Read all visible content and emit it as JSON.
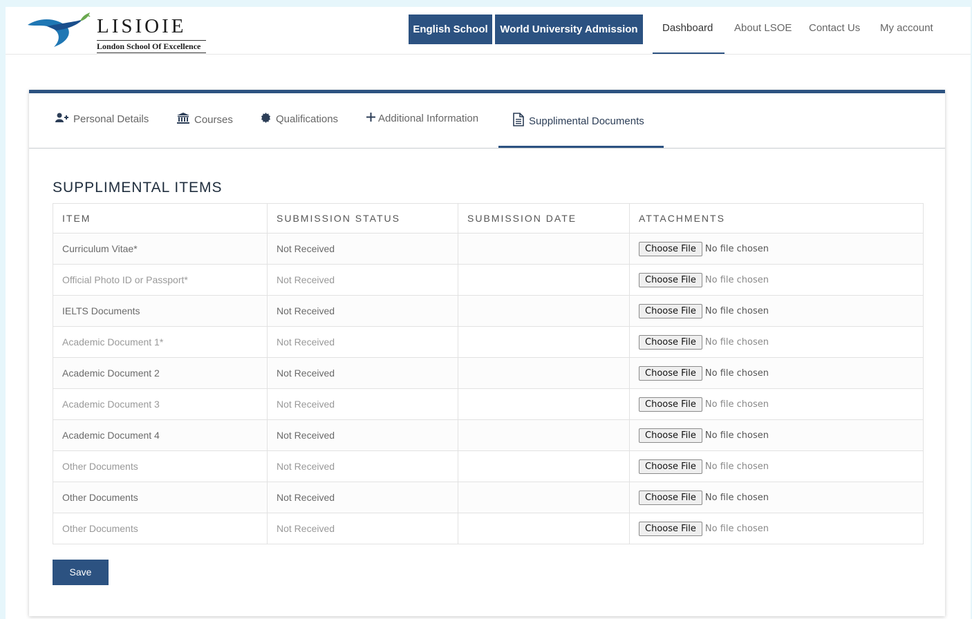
{
  "brand": {
    "name": "LISIOIE",
    "subtitle": "London School Of Excellence"
  },
  "header": {
    "buttons": [
      "English School",
      "World University Admission"
    ],
    "nav": [
      "Dashboard",
      "About LSOE",
      "Contact Us",
      "My account"
    ],
    "active_nav": "Dashboard"
  },
  "tabs": [
    {
      "label": "Personal Details",
      "icon": "user-plus-icon"
    },
    {
      "label": "Courses",
      "icon": "institution-icon"
    },
    {
      "label": "Qualifications",
      "icon": "certificate-icon"
    },
    {
      "label": "Additional Information",
      "icon": "plus-icon"
    },
    {
      "label": "Supplimental Documents",
      "icon": "document-icon"
    }
  ],
  "active_tab": "Supplimental Documents",
  "section": {
    "title": "SUPPLIMENTAL ITEMS",
    "columns": [
      "ITEM",
      "SUBMISSION STATUS",
      "SUBMISSION DATE",
      "ATTACHMENTS"
    ],
    "rows": [
      {
        "item": "Curriculum Vitae*",
        "status": "Not Received",
        "date": "",
        "file_button": "Choose File",
        "file_status": "No file chosen"
      },
      {
        "item": "Official Photo ID or Passport*",
        "status": "Not Received",
        "date": "",
        "file_button": "Choose File",
        "file_status": "No file chosen"
      },
      {
        "item": "IELTS Documents",
        "status": "Not Received",
        "date": "",
        "file_button": "Choose File",
        "file_status": "No file chosen"
      },
      {
        "item": "Academic Document 1*",
        "status": "Not Received",
        "date": "",
        "file_button": "Choose File",
        "file_status": "No file chosen"
      },
      {
        "item": "Academic Document 2",
        "status": "Not Received",
        "date": "",
        "file_button": "Choose File",
        "file_status": "No file chosen"
      },
      {
        "item": "Academic Document 3",
        "status": "Not Received",
        "date": "",
        "file_button": "Choose File",
        "file_status": "No file chosen"
      },
      {
        "item": "Academic Document 4",
        "status": "Not Received",
        "date": "",
        "file_button": "Choose File",
        "file_status": "No file chosen"
      },
      {
        "item": "Other Documents",
        "status": "Not Received",
        "date": "",
        "file_button": "Choose File",
        "file_status": "No file chosen"
      },
      {
        "item": "Other Documents",
        "status": "Not Received",
        "date": "",
        "file_button": "Choose File",
        "file_status": "No file chosen"
      },
      {
        "item": "Other Documents",
        "status": "Not Received",
        "date": "",
        "file_button": "Choose File",
        "file_status": "No file chosen"
      }
    ]
  },
  "save_label": "Save",
  "colors": {
    "primary": "#2c5281",
    "page_background": "#e6f6fb",
    "text_muted": "#666666"
  }
}
